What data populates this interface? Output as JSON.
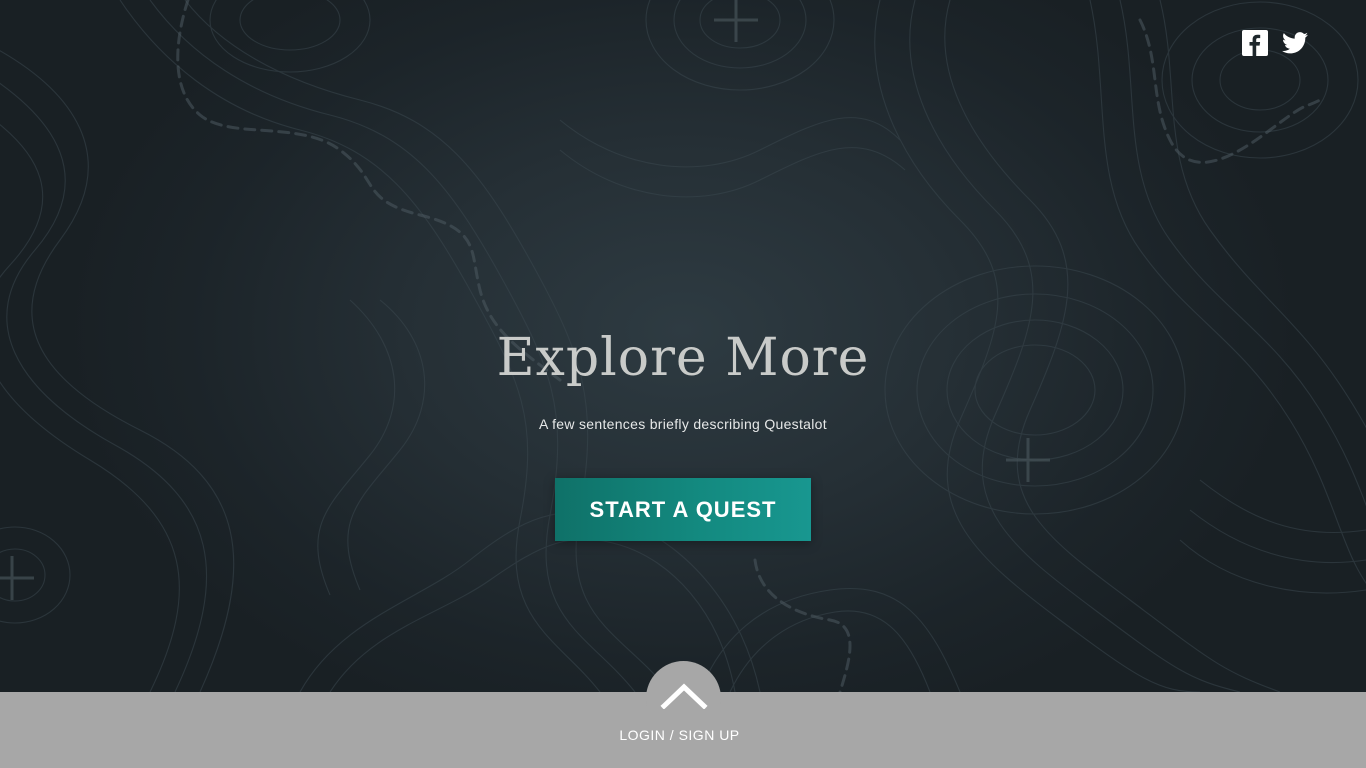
{
  "hero": {
    "title": "Explore More",
    "subtitle": "A few sentences briefly describing Questalot",
    "cta_label": "START A QUEST"
  },
  "social": {
    "facebook_icon": "facebook-icon",
    "twitter_icon": "twitter-icon"
  },
  "footer": {
    "expand_icon": "chevron-up-icon",
    "login_label": "LOGIN / SIGN UP"
  },
  "colors": {
    "background": "#1e272c",
    "accent": "#13897f",
    "footer_bar": "#a7a7a7",
    "title_text": "#c9cbc9"
  }
}
